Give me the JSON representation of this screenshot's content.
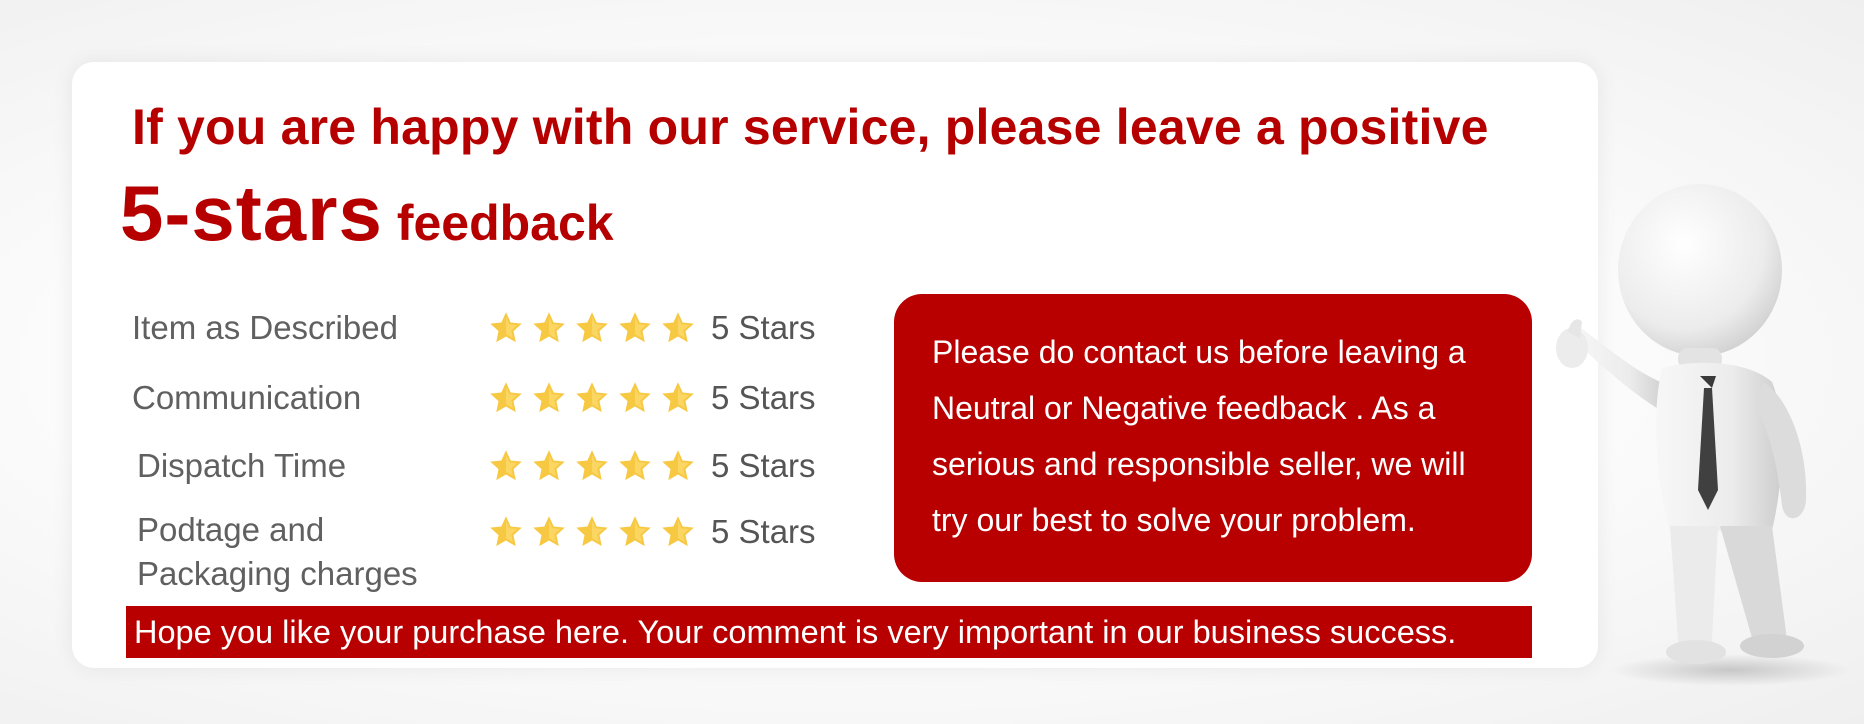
{
  "headline": {
    "line1": "If you are happy with our service, please leave a positive",
    "big_text": "5-stars",
    "small_text": "feedback"
  },
  "ratings": [
    {
      "label_lines": [
        "Item as Described"
      ],
      "stars": 5,
      "value_text": "5 Stars"
    },
    {
      "label_lines": [
        "Communication"
      ],
      "stars": 5,
      "value_text": "5 Stars"
    },
    {
      "label_lines": [
        "Dispatch Time"
      ],
      "stars": 5,
      "value_text": "5 Stars"
    },
    {
      "label_lines": [
        "Podtage and",
        "Packaging charges"
      ],
      "stars": 5,
      "value_text": "5 Stars"
    }
  ],
  "notice": {
    "lines": [
      "Please do contact us before leaving a",
      "Neutral or Negative  feedback . As a",
      "serious and responsible seller, we will",
      "try our best to solve your problem."
    ]
  },
  "footer": {
    "text": "Hope you like your purchase here. Your comment is very important in our business success."
  },
  "colors": {
    "brand_red": "#b60000",
    "box_red": "#b80000",
    "star_yellow": "#f7c842",
    "label_gray": "#606060"
  },
  "icons": {
    "star": "star-icon",
    "figure": "presenter-figure-icon"
  }
}
